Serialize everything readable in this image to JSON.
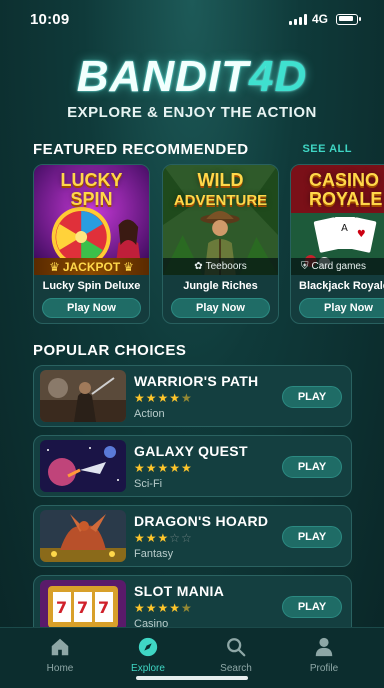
{
  "status_bar": {
    "time": "10:09",
    "network": "4G"
  },
  "header": {
    "logo_main": "BANDIT",
    "logo_accent": "4D",
    "tagline": "EXPLORE & ENJOY THE ACTION"
  },
  "featured": {
    "title": "FEATURED RECOMMENDED",
    "see_all": "SEE ALL",
    "cards": [
      {
        "art_line1": "LUCKY",
        "art_line2": "SPIN",
        "tag": "JACKPOT",
        "name": "Lucky Spin Deluxe",
        "button": "Play Now"
      },
      {
        "art_line1": "WILD",
        "art_line2": "ADVENTURE",
        "tag": "Teeboors",
        "name": "Jungle Riches",
        "button": "Play Now"
      },
      {
        "art_line1": "CASINO",
        "art_line2": "ROYALE",
        "tag": "Card games",
        "name": "Blackjack Royale",
        "button": "Play Now"
      }
    ]
  },
  "popular": {
    "title": "POPULAR CHOICES",
    "items": [
      {
        "title": "WARRIOR'S PATH",
        "rating": 4.5,
        "stars": "★★★★",
        "stars_off": "★",
        "genre": "Action",
        "button": "PLAY"
      },
      {
        "title": "GALAXY QUEST",
        "rating": 5,
        "stars": "★★★★★",
        "stars_off": "",
        "genre": "Sci-Fi",
        "button": "PLAY"
      },
      {
        "title": "DRAGON'S HOARD",
        "rating": 3,
        "stars": "★★★",
        "stars_off": "☆☆",
        "genre": "Fantasy",
        "button": "PLAY"
      },
      {
        "title": "SLOT MANIA",
        "rating": 4.5,
        "stars": "★★★★",
        "stars_off": "★",
        "genre": "Casino",
        "button": "PLAY"
      }
    ]
  },
  "nav": {
    "items": [
      {
        "label": "Home",
        "icon": "home-icon"
      },
      {
        "label": "Explore",
        "icon": "compass-icon",
        "active": true
      },
      {
        "label": "Search",
        "icon": "search-icon"
      },
      {
        "label": "Profile",
        "icon": "profile-icon"
      }
    ]
  },
  "colors": {
    "accent": "#3fd6c4",
    "button": "#1f6c66",
    "star": "#ffc62b",
    "background": "#0f3a3a"
  }
}
